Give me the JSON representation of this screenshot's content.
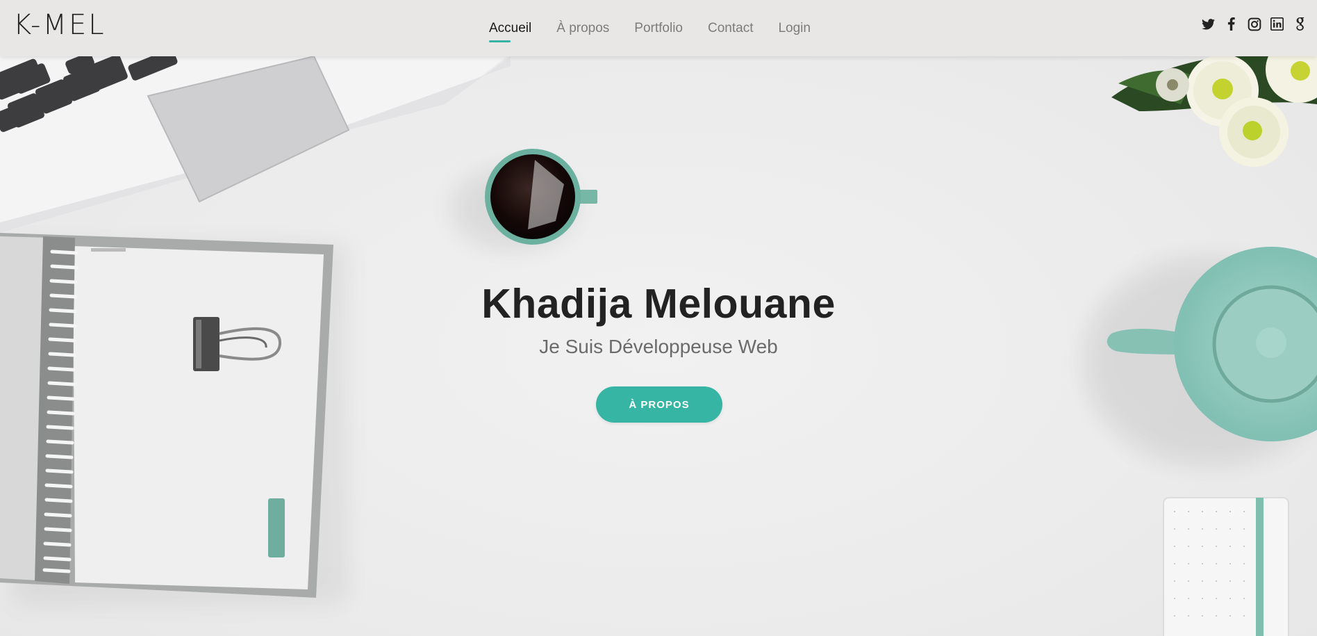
{
  "header": {
    "logo": "K-MEL",
    "nav": [
      {
        "label": "Accueil",
        "active": true
      },
      {
        "label": "À propos",
        "active": false
      },
      {
        "label": "Portfolio",
        "active": false
      },
      {
        "label": "Contact",
        "active": false
      },
      {
        "label": "Login",
        "active": false
      }
    ],
    "social_icons": [
      "twitter-icon",
      "facebook-icon",
      "instagram-icon",
      "linkedin-icon",
      "google-icon"
    ]
  },
  "hero": {
    "title": "Khadija Melouane",
    "subtitle": "Je Suis Développeuse Web",
    "button_label": "À PROPOS"
  },
  "colors": {
    "accent": "#36b5a5",
    "header_bg": "#e8e7e5",
    "background": "#ececec",
    "title": "#222222",
    "nav_inactive": "#7c7c7c"
  }
}
